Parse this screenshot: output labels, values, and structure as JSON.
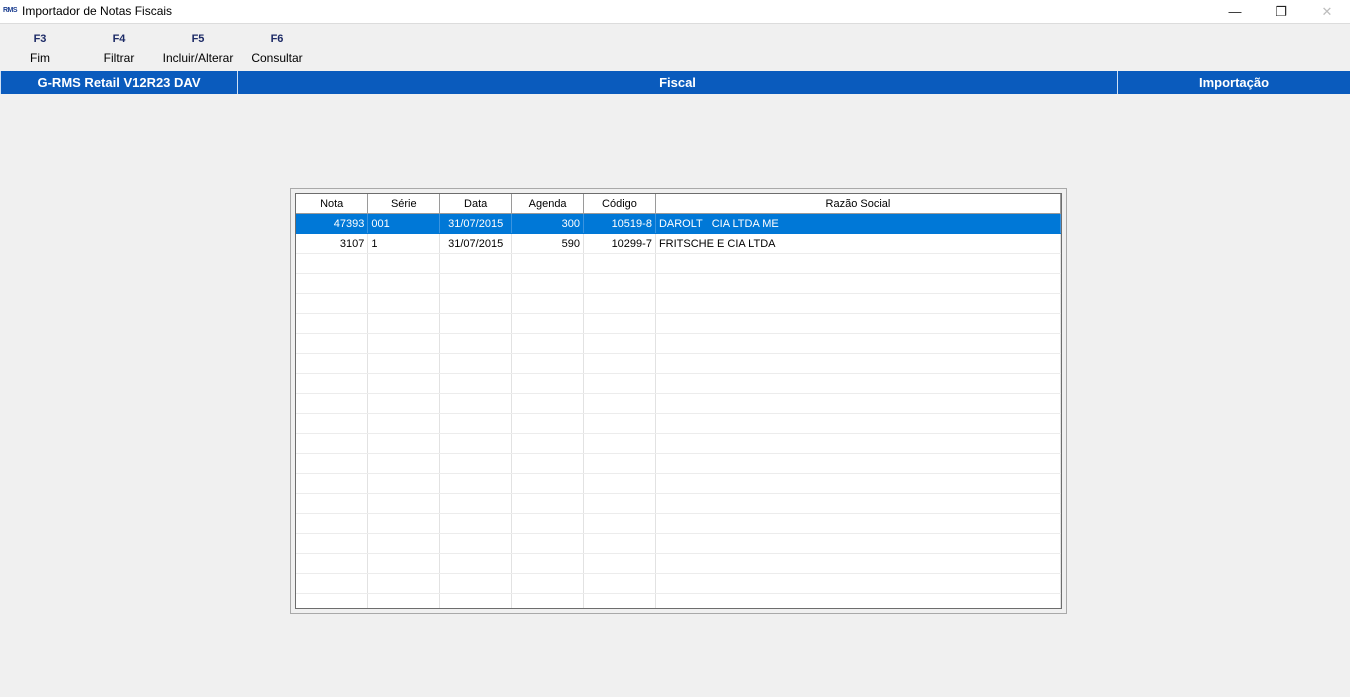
{
  "window": {
    "title": "Importador de Notas Fiscais",
    "icon_text": "RMS",
    "minimize_glyph": "—",
    "restore_glyph": "❐",
    "close_glyph": "✕"
  },
  "toolbar": {
    "items": [
      {
        "key": "F3",
        "label": "Fim"
      },
      {
        "key": "F4",
        "label": "Filtrar"
      },
      {
        "key": "F5",
        "label": "Incluir/Alterar"
      },
      {
        "key": "F6",
        "label": "Consultar"
      }
    ]
  },
  "status": {
    "product": "G-RMS Retail V12R23 DAV",
    "module": "Fiscal",
    "function": "Importação"
  },
  "colors": {
    "status_bar": "#0a5bbd",
    "selection": "#0078d7",
    "toolbar_key": "#1c2a66"
  },
  "grid": {
    "columns": [
      "Nota",
      "Série",
      "Data",
      "Agenda",
      "Código",
      "Razão Social"
    ],
    "rows": [
      {
        "nota": "47393",
        "serie": "001",
        "data": "31/07/2015",
        "agenda": "300",
        "codigo": "10519-8",
        "razao_social": "DAROLT   CIA LTDA ME",
        "selected": true
      },
      {
        "nota": "3107",
        "serie": "1",
        "data": "31/07/2015",
        "agenda": "590",
        "codigo": "10299-7",
        "razao_social": "FRITSCHE E CIA LTDA",
        "selected": false
      }
    ]
  }
}
